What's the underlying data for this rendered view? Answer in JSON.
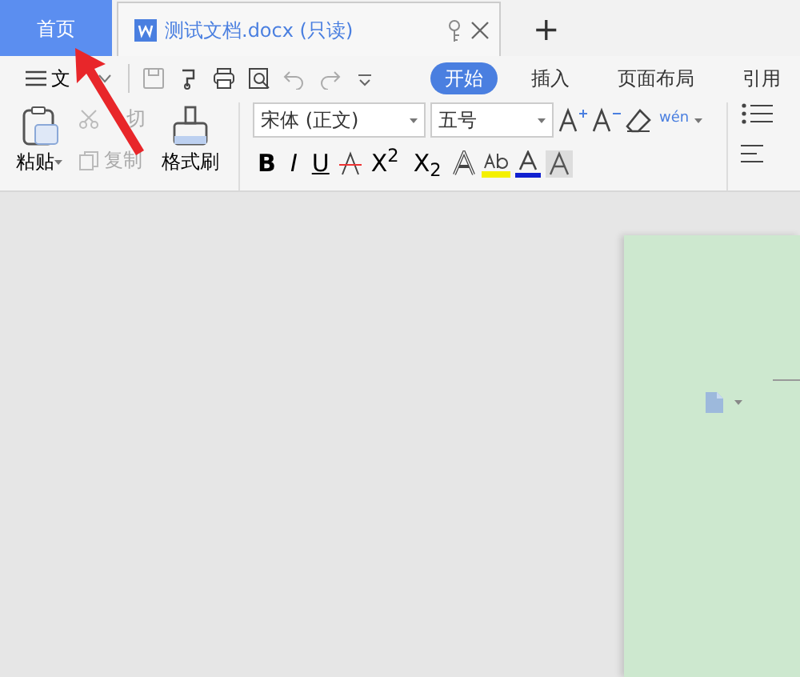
{
  "tabs": [
    {
      "kind": "home",
      "label": "首页",
      "selected": true
    },
    {
      "kind": "document",
      "label": "测试文档.docx (只读)",
      "selected": false
    }
  ],
  "new_tab": "+",
  "menu": {
    "label": "文"
  },
  "ribbon_tabs": [
    {
      "label": "开始",
      "selected": true
    },
    {
      "label": "插入",
      "selected": false
    },
    {
      "label": "页面布局",
      "selected": false
    },
    {
      "label": "引用",
      "selected": false
    }
  ],
  "clipboard": {
    "paste": "粘贴",
    "cut": {
      "label": "切",
      "disabled": true
    },
    "copy": {
      "label": "复制",
      "disabled": true
    },
    "format_painter": "格式刷"
  },
  "font": {
    "name": "宋体 (正文)",
    "size": "五号"
  },
  "format_buttons": [
    "B",
    "I",
    "U"
  ],
  "script_buttons": [
    "X$^{2}$",
    "X$_{2}$"
  ],
  "phonetic": "wén"
}
